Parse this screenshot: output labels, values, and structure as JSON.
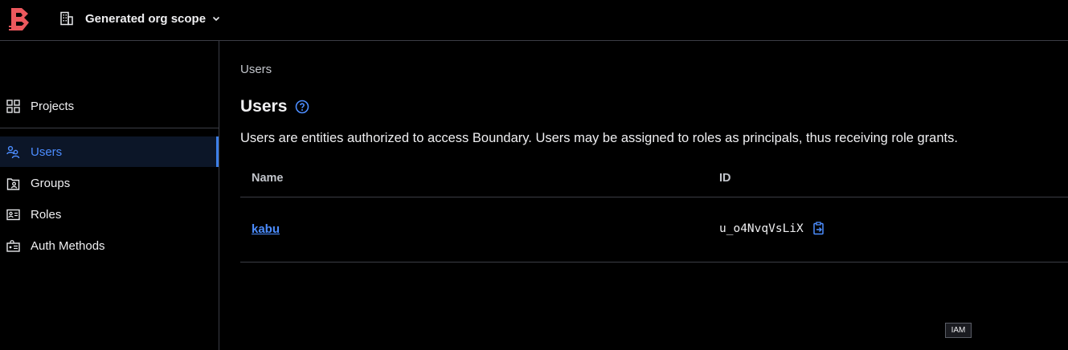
{
  "header": {
    "logo": "boundary-logo",
    "scope_label": "Generated org scope",
    "scope_icon": "building-icon",
    "chevron_icon": "chevron-down-icon"
  },
  "sidebar": {
    "items": [
      {
        "label": "Projects",
        "icon": "grid-icon",
        "active": false
      },
      {
        "label": "Users",
        "icon": "users-icon",
        "active": true
      },
      {
        "label": "Groups",
        "icon": "groups-icon",
        "active": false
      },
      {
        "label": "Roles",
        "icon": "id-card-icon",
        "active": false
      },
      {
        "label": "Auth Methods",
        "icon": "auth-icon",
        "active": false
      }
    ]
  },
  "main": {
    "breadcrumb": "Users",
    "title": "Users",
    "description": "Users are entities authorized to access Boundary. Users may be assigned to roles as principals, thus receiving role grants.",
    "table": {
      "columns": [
        "Name",
        "ID"
      ],
      "rows": [
        {
          "name": "kabu",
          "id": "u_o4NvqVsLiX"
        }
      ]
    }
  },
  "tag": "IAM",
  "colors": {
    "accent": "#4c8dff",
    "brand_red": "#ec585d",
    "border": "#3b3d45",
    "active_bg": "#0c1628"
  }
}
